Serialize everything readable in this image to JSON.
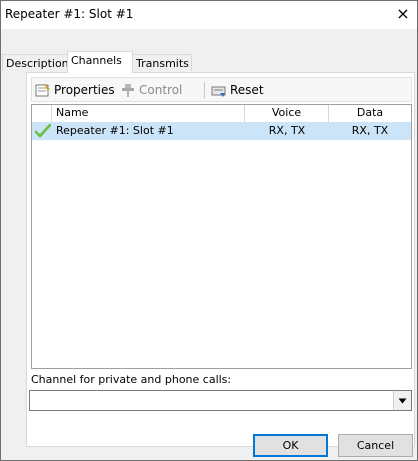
{
  "window": {
    "title": "Repeater #1: Slot #1",
    "close_label": "×"
  },
  "tabs": [
    {
      "label": "Description",
      "active": false
    },
    {
      "label": "Channels",
      "active": true
    },
    {
      "label": "Transmits",
      "active": false
    }
  ],
  "toolbar": {
    "properties_label": "Properties",
    "control_label": "Control",
    "reset_label": "Reset",
    "properties_icon": "properties-icon",
    "control_icon": "control-icon",
    "reset_icon": "reset-icon"
  },
  "list": {
    "columns": [
      "Name",
      "Voice",
      "Data"
    ],
    "rows": [
      {
        "name": "Repeater #1: Slot #1",
        "voice": "RX, TX",
        "data": "RX, TX",
        "checked": true,
        "selected": true
      }
    ]
  },
  "private_calls": {
    "label": "Channel for private and phone calls:",
    "value": ""
  },
  "buttons": {
    "ok": "OK",
    "cancel": "Cancel"
  },
  "colors": {
    "selection": "#cce4f7",
    "check": "#6cbf3c",
    "accent": "#0078d7"
  }
}
